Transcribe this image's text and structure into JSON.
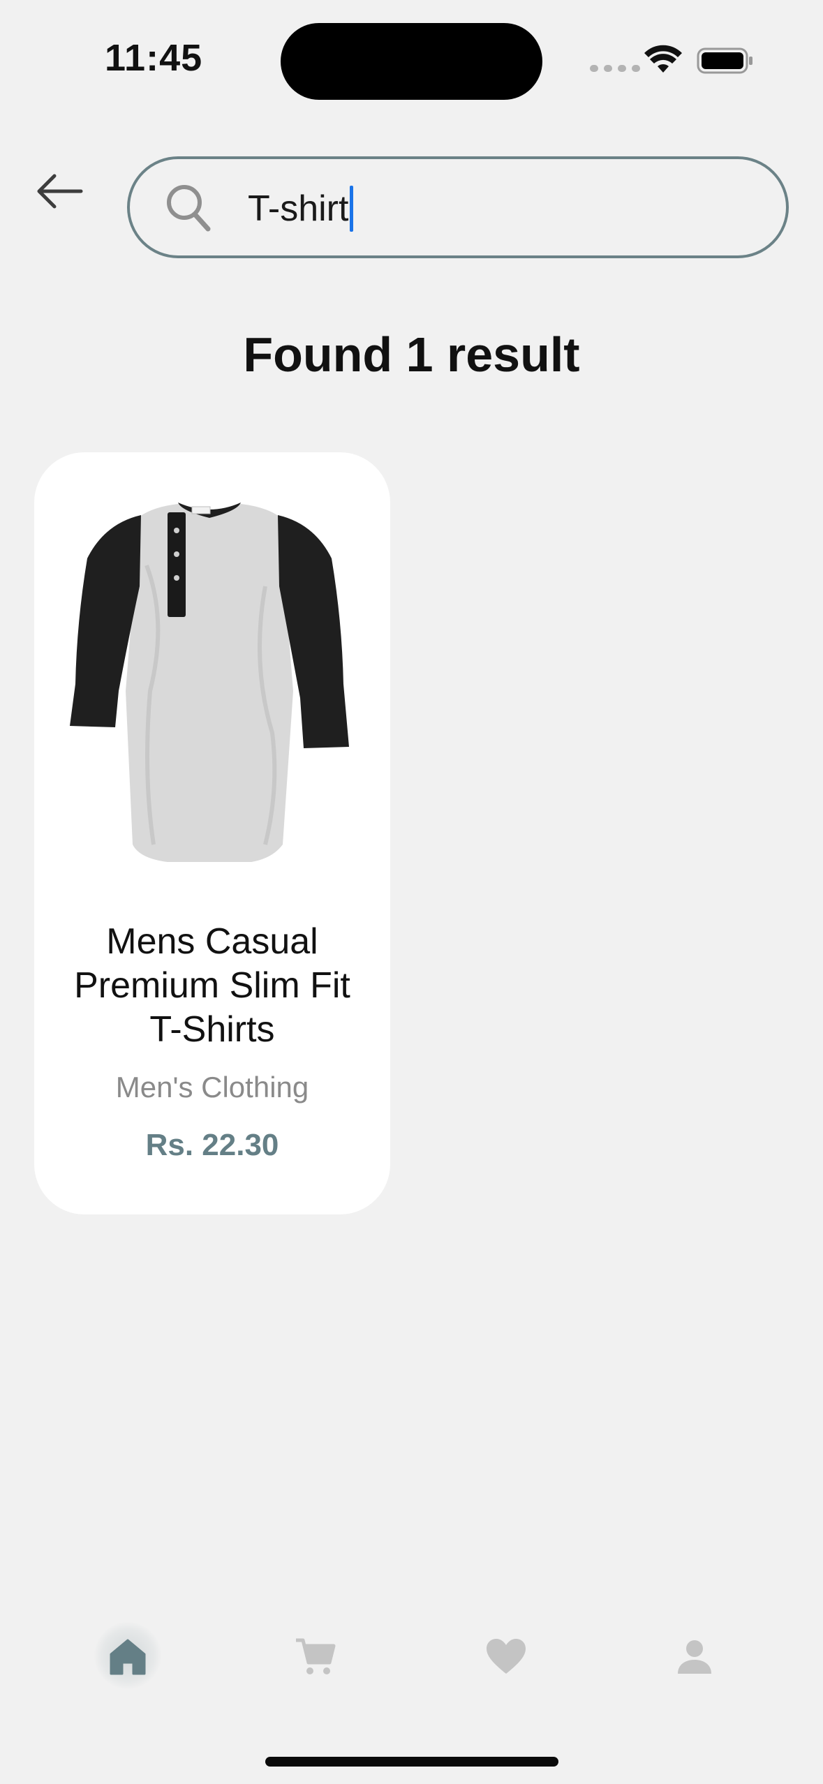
{
  "status_bar": {
    "time": "11:45"
  },
  "search": {
    "value": "T-shirt"
  },
  "results": {
    "title": "Found 1 result"
  },
  "products": [
    {
      "name": "Mens Casual Premium Slim Fit T-Shirts",
      "category": "Men's Clothing",
      "price": "Rs. 22.30"
    }
  ],
  "nav": {
    "items": [
      {
        "icon": "home-icon",
        "active": true
      },
      {
        "icon": "cart-icon",
        "active": false
      },
      {
        "icon": "heart-icon",
        "active": false
      },
      {
        "icon": "profile-icon",
        "active": false
      }
    ]
  },
  "colors": {
    "accent": "#647f86",
    "inactive_icon": "#c4c4c4",
    "background": "#f1f1f1",
    "card": "#ffffff",
    "caret": "#1a73e8"
  }
}
